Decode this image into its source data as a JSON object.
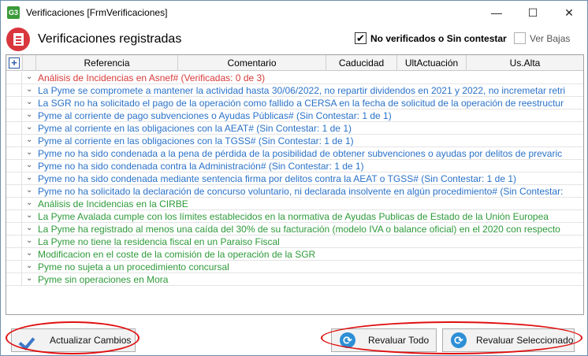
{
  "window": {
    "app_icon_text": "G3",
    "title": "Verificaciones [FrmVerificaciones]",
    "minimize": "—",
    "maximize": "☐",
    "close": "✕"
  },
  "header": {
    "title": "Verificaciones registradas",
    "filter_unverified": {
      "label": "No verificados o Sin contestar",
      "checked": true,
      "mark": "✔"
    },
    "filter_bajas": {
      "label": "Ver Bajas",
      "checked": false
    }
  },
  "grid": {
    "add_label": "+",
    "columns": [
      "Referencia",
      "Comentario",
      "Caducidad",
      "UltActuación",
      "Us.Alta"
    ],
    "expander_glyph": "⌄",
    "rows": [
      {
        "text": "Análisis de Incidencias en Asnef# (Verificadas: 0 de 3)",
        "color": "#d83a3a"
      },
      {
        "text": "La Pyme se compromete a mantener la actividad hasta 30/06/2022, no repartir dividendos en 2021 y 2022, no incremetar retri",
        "color": "#2a72c8"
      },
      {
        "text": "La SGR no ha solicitado el pago de la operación como fallido a CERSA en la fecha de solicitud de la operación de reestructur",
        "color": "#2a72c8"
      },
      {
        "text": "Pyme al corriente de pago subvenciones o Ayudas Públicas# (Sin Contestar: 1 de 1)",
        "color": "#2a72c8"
      },
      {
        "text": "Pyme al corriente en las obligaciones con la AEAT# (Sin Contestar: 1 de 1)",
        "color": "#2a72c8"
      },
      {
        "text": "Pyme al corriente en las obligaciones con la TGSS# (Sin Contestar: 1 de 1)",
        "color": "#2a72c8"
      },
      {
        "text": "Pyme no ha sido condenada a la pena de pérdida de la posibilidad de obtener subvenciones o ayudas por delitos de prevaric",
        "color": "#2a72c8"
      },
      {
        "text": "Pyme no ha sido condenada contra la Administración# (Sin Contestar: 1 de 1)",
        "color": "#2a72c8"
      },
      {
        "text": "Pyme no ha sido condenada mediante sentencia firma por delitos contra la AEAT o TGSS# (Sin Contestar: 1 de 1)",
        "color": "#2a72c8"
      },
      {
        "text": "Pyme no ha solicitado la declaración de concurso voluntario, ni declarada insolvente en algún procedimiento# (Sin Contestar:",
        "color": "#2a72c8"
      },
      {
        "text": "Análisis de Incidencias en la CIRBE",
        "color": "#2e9a3a"
      },
      {
        "text": "La Pyme Avalada cumple con los límites establecidos en la normativa de Ayudas Publicas de Estado de la Unión Europea",
        "color": "#2e9a3a"
      },
      {
        "text": "La Pyme ha registrado al menos una caída del 30% de su facturación (modelo IVA o balance oficial) en el 2020 con respecto",
        "color": "#2e9a3a"
      },
      {
        "text": "La Pyme no tiene la residencia fiscal en un Paraiso Fiscal",
        "color": "#2e9a3a"
      },
      {
        "text": "Modificacion en el coste de la comisión de la operación de la SGR",
        "color": "#2e9a3a"
      },
      {
        "text": "Pyme no sujeta a un procedimiento concursal",
        "color": "#2e9a3a"
      },
      {
        "text": "Pyme sin operaciones en Mora",
        "color": "#2e9a3a"
      }
    ]
  },
  "footer": {
    "actualizar_label": "Actualizar Cambios",
    "revaluar_todo_label": "Revaluar Todo",
    "revaluar_sel_label": "Revaluar Seleccionado",
    "sync_glyph": "⟳"
  },
  "colors": {
    "highlight": "#e01010",
    "accent": "#2d8fd6"
  }
}
